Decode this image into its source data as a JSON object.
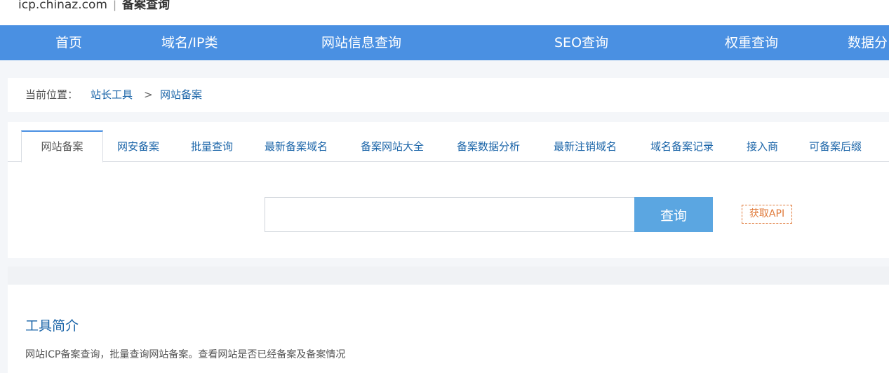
{
  "header": {
    "domain": "icp.chinaz.com",
    "separator": "|",
    "title": "备案查询"
  },
  "nav": {
    "items": [
      {
        "label": "首页"
      },
      {
        "label": "域名/IP类"
      },
      {
        "label": "网站信息查询"
      },
      {
        "label": "SEO查询"
      },
      {
        "label": "权重查询"
      },
      {
        "label": "数据分"
      }
    ]
  },
  "breadcrumb": {
    "label": "当前位置：",
    "links": [
      "站长工具",
      "网站备案"
    ],
    "separator": ">"
  },
  "tabs": [
    {
      "label": "网站备案",
      "active": true
    },
    {
      "label": "网安备案"
    },
    {
      "label": "批量查询"
    },
    {
      "label": "最新备案域名"
    },
    {
      "label": "备案网站大全"
    },
    {
      "label": "备案数据分析"
    },
    {
      "label": "最新注销域名"
    },
    {
      "label": "域名备案记录"
    },
    {
      "label": "接入商"
    },
    {
      "label": "可备案后缀"
    }
  ],
  "search": {
    "value": "",
    "placeholder": "",
    "button_label": "查询",
    "api_label": "获取API"
  },
  "intro": {
    "title": "工具简介",
    "text": "网站ICP备案查询，批量查询网站备案。查看网站是否已经备案及备案情况"
  },
  "colors": {
    "nav_bg": "#4a90e2",
    "link": "#1a64a8",
    "search_button": "#5ba6e1",
    "api_accent": "#e07a3a"
  }
}
